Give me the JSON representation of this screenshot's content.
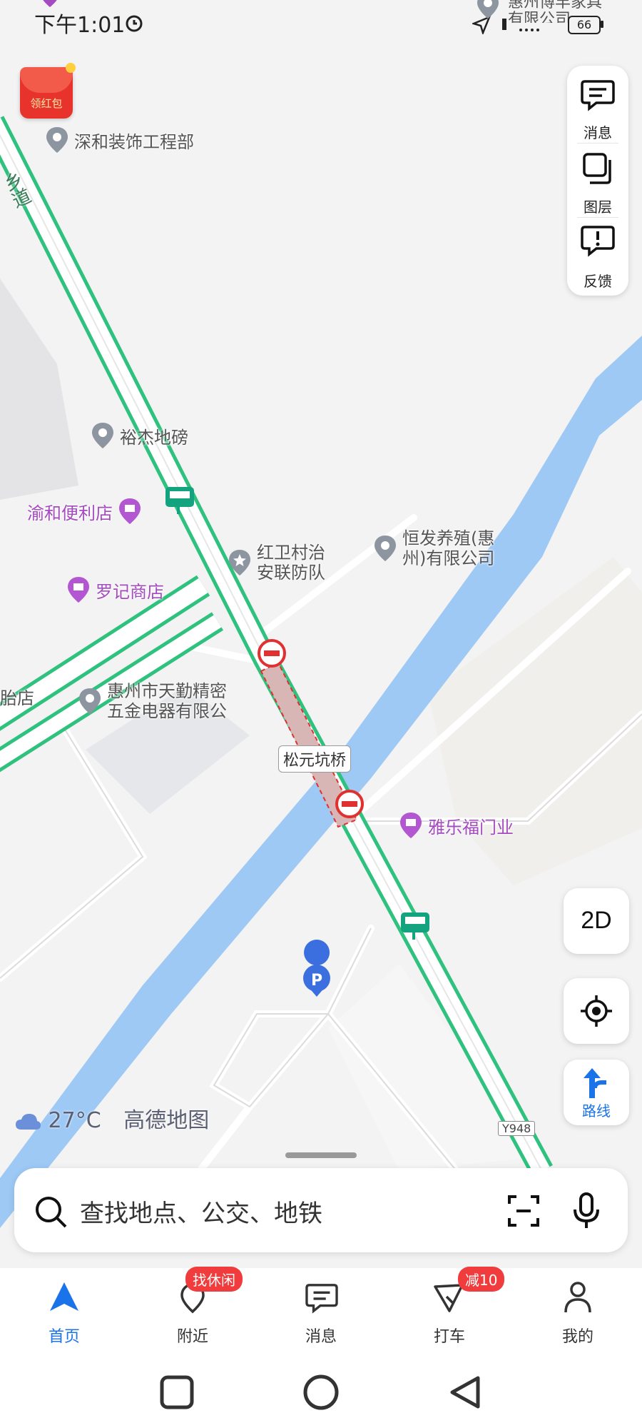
{
  "status_bar": {
    "time": "下午1:01",
    "battery": "66"
  },
  "top_partial_poi": "惠州博丰家具有限公司",
  "red_packet": {
    "label": "领红包"
  },
  "road_label": "乡道",
  "pois": [
    {
      "name": "深和装饰工程部",
      "type": "gray"
    },
    {
      "name": "裕杰地磅",
      "type": "gray"
    },
    {
      "name": "渝和便利店",
      "type": "purple"
    },
    {
      "name": "罗记商店",
      "type": "purple"
    },
    {
      "name": "红卫村治安联防队",
      "line1": "红卫村治",
      "line2": "安联防队",
      "type": "gray-star"
    },
    {
      "name": "恒发养殖(惠州)有限公司",
      "line1": "恒发养殖(惠",
      "line2": "州)有限公司",
      "type": "gray"
    },
    {
      "name": "胎店",
      "type": "partial"
    },
    {
      "name": "惠州市天勤精密五金电器有限公",
      "line1": "惠州市天勤精密",
      "line2": "五金电器有限公",
      "type": "gray"
    },
    {
      "name": "雅乐福门业",
      "type": "purple"
    }
  ],
  "bridge_label": "松元坑桥",
  "road_code": "Y948",
  "right_panel": [
    {
      "label": "消息",
      "icon": "message-icon"
    },
    {
      "label": "图层",
      "icon": "layers-icon"
    },
    {
      "label": "反馈",
      "icon": "feedback-icon"
    }
  ],
  "view_mode": "2D",
  "route_label": "路线",
  "weather": {
    "temp": "27°C",
    "brand": "高德地图"
  },
  "search": {
    "placeholder": "查找地点、公交、地铁"
  },
  "tabs": [
    {
      "label": "首页",
      "active": true
    },
    {
      "label": "附近",
      "badge": "找休闲"
    },
    {
      "label": "消息"
    },
    {
      "label": "打车",
      "badge": "减10"
    },
    {
      "label": "我的"
    }
  ],
  "colors": {
    "accent": "#1a73e8",
    "river": "#9ec9f5",
    "road_green": "#2ec27e",
    "badge": "#f03c3c"
  }
}
